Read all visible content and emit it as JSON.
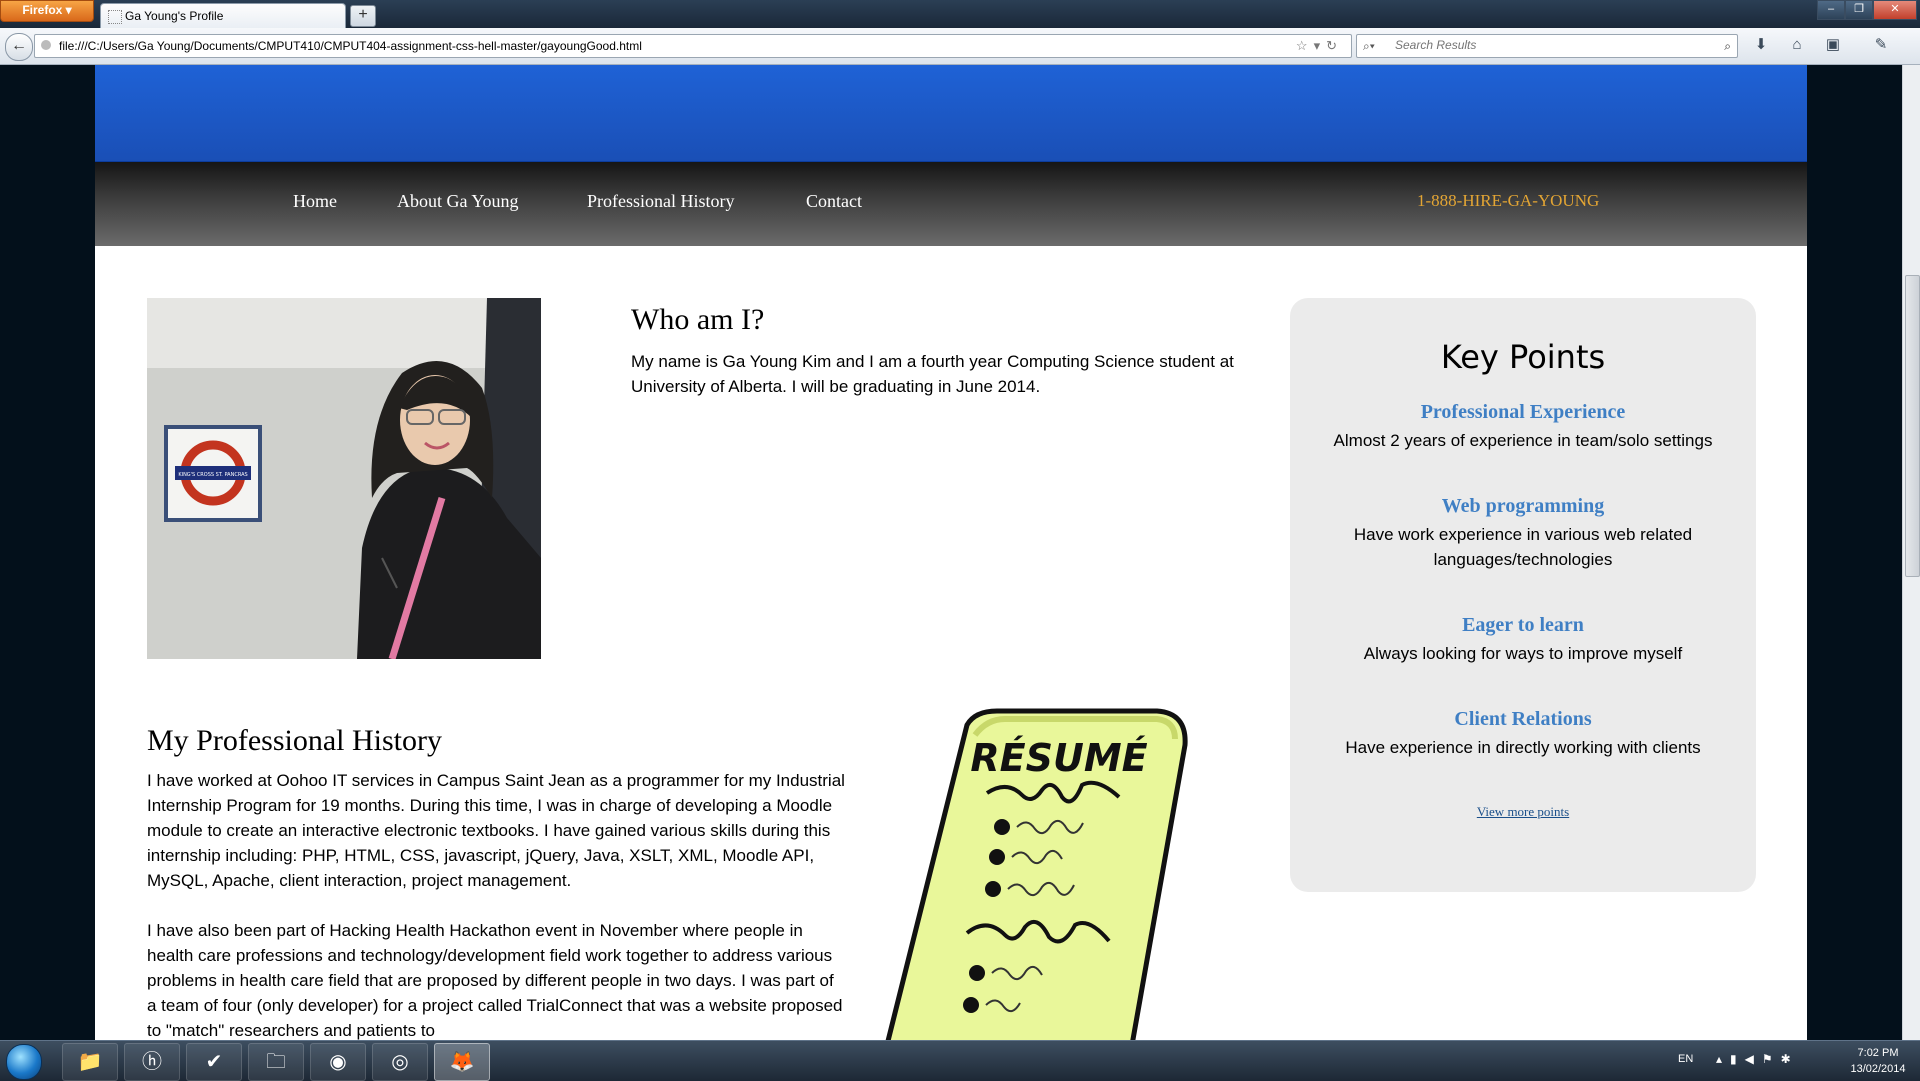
{
  "browser": {
    "menu_button": "Firefox",
    "tab_title": "Ga Young's Profile",
    "new_tab": "+",
    "url": "file:///C:/Users/Ga Young/Documents/CMPUT410/CMPUT404-assignment-css-hell-master/gayoungGood.html",
    "search_placeholder": "Search Results",
    "window_controls": [
      "minimize",
      "restore",
      "close"
    ]
  },
  "page": {
    "nav": [
      "Home",
      "About Ga Young",
      "Professional History",
      "Contact"
    ],
    "phone": "1-888-HIRE-GA-YOUNG",
    "who": {
      "heading": "Who am I?",
      "text": "My name is Ga Young Kim and I am a fourth year Computing Science student at University of Alberta. I will be graduating in June 2014."
    },
    "history": {
      "heading": "My Professional History",
      "paragraphs": [
        "I have worked at Oohoo IT services in Campus Saint Jean as a programmer for my Industrial Internship Program for 19 months. During this time, I was in charge of developing a Moodle module to create an interactive electronic textbooks. I have gained various skills during this internship including: PHP, HTML, CSS, javascript, jQuery, Java, XSLT, XML, Moodle API, MySQL, Apache, client interaction, project management.",
        "I have also been part of Hacking Health Hackathon event in November where people in health care professions and technology/development field work together to address various problems in health care field that are proposed by different people in two days. I was part of a team of four (only developer) for a project called TrialConnect that was a website proposed to \"match\" researchers and patients to"
      ]
    },
    "resume_image_text": "RÉSUMÉ",
    "key_points": {
      "title": "Key Points",
      "items": [
        {
          "heading": "Professional Experience",
          "body": "Almost 2 years of experience in team/solo settings"
        },
        {
          "heading": "Web programming",
          "body": "Have work experience in various web related languages/technologies"
        },
        {
          "heading": "Eager to learn",
          "body": "Always looking for ways to improve myself"
        },
        {
          "heading": "Client Relations",
          "body": "Have experience in directly working with clients"
        }
      ],
      "more_link": "View more points"
    },
    "photo_sign_text": "KING'S CROSS ST. PANCRAS"
  },
  "taskbar": {
    "language": "EN",
    "time": "7:02 PM",
    "date": "13/02/2014",
    "apps": [
      "explorer",
      "hp",
      "check",
      "folder",
      "chrome",
      "eclipse",
      "firefox"
    ]
  },
  "colors": {
    "banner": "#1f62d6",
    "phone": "#e3a534",
    "key_point_heading": "#3f7fc4",
    "panel": "#ebebeb"
  }
}
